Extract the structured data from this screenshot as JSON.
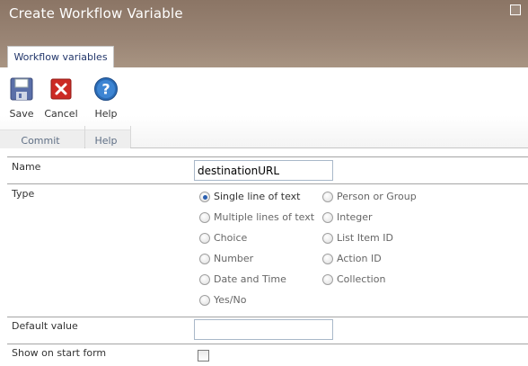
{
  "dialog": {
    "title": "Create Workflow Variable",
    "close_icon": "close-icon"
  },
  "ribbon": {
    "tab_label": "Workflow variables",
    "buttons": {
      "save": {
        "label": "Save",
        "icon": "save-disk-icon"
      },
      "cancel": {
        "label": "Cancel",
        "icon": "cancel-x-icon"
      },
      "help": {
        "label": "Help",
        "icon": "help-question-icon"
      }
    },
    "groups": {
      "commit": "Commit",
      "help": "Help"
    },
    "colors": {
      "help_icon": "#2b6cb6",
      "cancel_icon": "#cc2a24",
      "save_icon": "#5a6fa8"
    }
  },
  "form": {
    "name": {
      "label": "Name",
      "value": "destinationURL"
    },
    "type": {
      "label": "Type",
      "selected": "Single line of text",
      "options_left": [
        "Single line of text",
        "Multiple lines of text",
        "Choice",
        "Number",
        "Date and Time",
        "Yes/No"
      ],
      "options_right": [
        "Person or Group",
        "Integer",
        "List Item ID",
        "Action ID",
        "Collection"
      ]
    },
    "default_value": {
      "label": "Default value",
      "value": ""
    },
    "show_on_start_form": {
      "label": "Show on start form",
      "checked": false
    }
  }
}
